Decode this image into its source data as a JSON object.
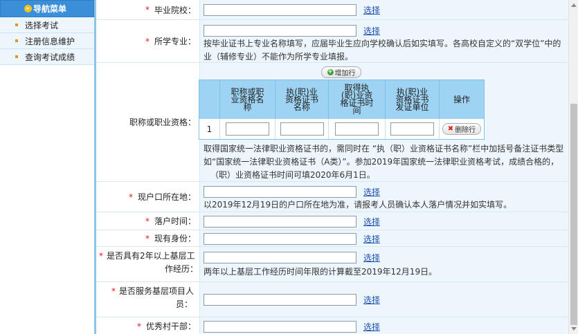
{
  "sidebar": {
    "title": "导航菜单",
    "items": [
      {
        "label": "选择考试"
      },
      {
        "label": "注册信息维护"
      },
      {
        "label": "查询考试成绩"
      }
    ]
  },
  "form": {
    "select_label": "选择",
    "rows": {
      "school": {
        "label": "毕业院校："
      },
      "major": {
        "label": "所学专业：",
        "hint_1": "按毕业证书上专业名称填写，应届毕业生应向学校确认后如实填写。各高校自定义的“双学位”中的",
        "hint_2": "业（辅修专业）不能作为所学专业填报。"
      },
      "qualification": {
        "label": "职称或职业资格：",
        "add_button": "增加行",
        "headers": [
          "职称或职业资格名称",
          "执(职)业资格证书名称",
          "取得执(职)业资格证书时间",
          "执(职)业资格证书发证单位",
          "操作"
        ],
        "row_index": "1",
        "delete_button": "删除行",
        "hint_1": "取得国家统一法律职业资格证书的，需同时在 “执（职）业资格证书名称”栏中加括号备注证书类型",
        "hint_2": "如“国家统一法律职业资格证书（A类）”。参加2019年国家统一法律职业资格考试，成绩合格的，",
        "hint_3": "（职）业资格证书时间可填2020年6月1日。"
      },
      "residence": {
        "label": "现户口所在地：",
        "hint": "以2019年12月19日的户口所在地为准，请报考人员确认本人落户情况并如实填写。"
      },
      "settle_time": {
        "label": "落户时间："
      },
      "identity": {
        "label": "现有身份："
      },
      "grassroots": {
        "label_1": "是否具有2年以上基层工",
        "label_2": "作经历：",
        "hint": "两年以上基层工作经历时间年限的计算截至2019年12月19日。"
      },
      "project": {
        "label_1": "是否服务基层项目人",
        "label_2": "员："
      },
      "cadre": {
        "label": "优秀村干部："
      }
    }
  },
  "colors": {
    "nav_header": "#3a8fd8",
    "field_bg": "#eef6fd",
    "table_header": "#9fd3f3",
    "required": "#ee1122",
    "link": "#1a4fb0"
  }
}
